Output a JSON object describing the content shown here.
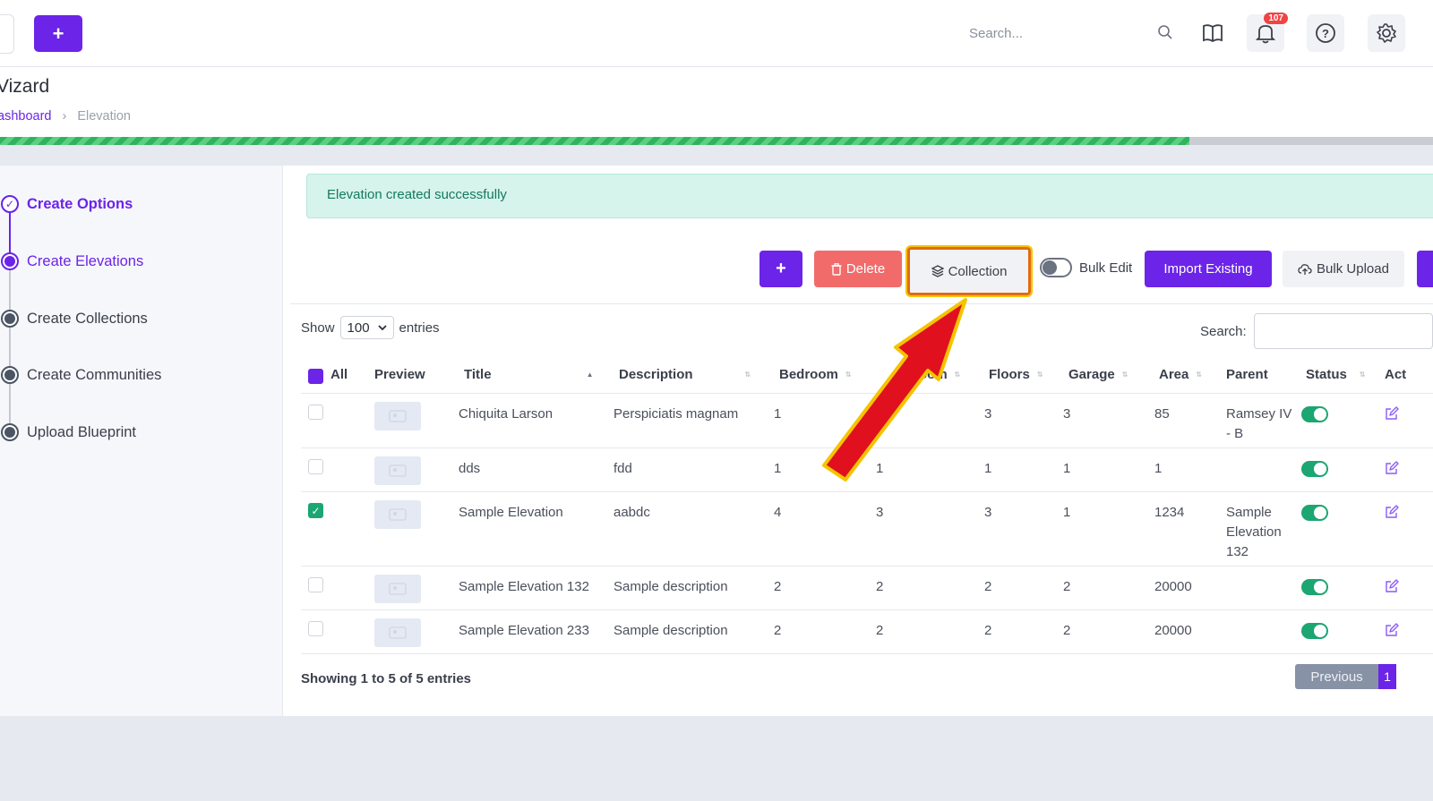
{
  "header": {
    "search_placeholder": "Search...",
    "notification_count": "107",
    "icons": [
      "book-icon",
      "bell-icon",
      "help-icon",
      "gear-icon"
    ]
  },
  "page": {
    "title": "Vizard",
    "breadcrumb": {
      "home": "ashboard",
      "separator": "›",
      "current": "Elevation"
    },
    "progress_fraction": 0.83
  },
  "steps": [
    {
      "label": "Create Options",
      "state": "done"
    },
    {
      "label": "Create Elevations",
      "state": "active"
    },
    {
      "label": "Create Collections",
      "state": "pending"
    },
    {
      "label": "Create Communities",
      "state": "pending"
    },
    {
      "label": "Upload Blueprint",
      "state": "pending"
    }
  ],
  "alert": {
    "message": "Elevation created successfully"
  },
  "toolbar": {
    "add_label": "+",
    "delete_label": "Delete",
    "collection_label": "Collection",
    "bulk_edit_label": "Bulk Edit",
    "import_label": "Import Existing",
    "bulk_upload_label": "Bulk Upload"
  },
  "table_controls": {
    "show_label": "Show",
    "page_size": "100",
    "entries_label": "entries",
    "search_label": "Search:"
  },
  "table": {
    "columns": {
      "all": "All",
      "preview": "Preview",
      "title": "Title",
      "description": "Description",
      "bedroom": "Bedroom",
      "bathroom": "throom",
      "floors": "Floors",
      "garage": "Garage",
      "area": "Area",
      "parent": "Parent",
      "status": "Status",
      "actions": "Act"
    },
    "rows": [
      {
        "checked": false,
        "title": "Chiquita Larson",
        "description": "Perspiciatis magnam",
        "bedroom": "1",
        "bathroom": "5",
        "floors": "3",
        "garage": "3",
        "area": "85",
        "parent": "Ramsey IV - B",
        "status": true
      },
      {
        "checked": false,
        "title": "dds",
        "description": "fdd",
        "bedroom": "1",
        "bathroom": "1",
        "floors": "1",
        "garage": "1",
        "area": "1",
        "parent": "",
        "status": true
      },
      {
        "checked": true,
        "title": "Sample Elevation",
        "description": "aabdc",
        "bedroom": "4",
        "bathroom": "3",
        "floors": "3",
        "garage": "1",
        "area": "1234",
        "parent": "Sample Elevation 132",
        "status": true
      },
      {
        "checked": false,
        "title": "Sample Elevation 132",
        "description": "Sample description",
        "bedroom": "2",
        "bathroom": "2",
        "floors": "2",
        "garage": "2",
        "area": "20000",
        "parent": "",
        "status": true
      },
      {
        "checked": false,
        "title": "Sample Elevation 233",
        "description": "Sample description",
        "bedroom": "2",
        "bathroom": "2",
        "floors": "2",
        "garage": "2",
        "area": "20000",
        "parent": "",
        "status": true
      }
    ]
  },
  "footer": {
    "info": "Showing 1 to 5 of 5 entries",
    "previous_label": "Previous",
    "current_page": "1"
  },
  "colors": {
    "accent": "#6b24e8",
    "success": "#1ba672",
    "danger": "#f26b6b",
    "highlight": "#e06c10"
  }
}
